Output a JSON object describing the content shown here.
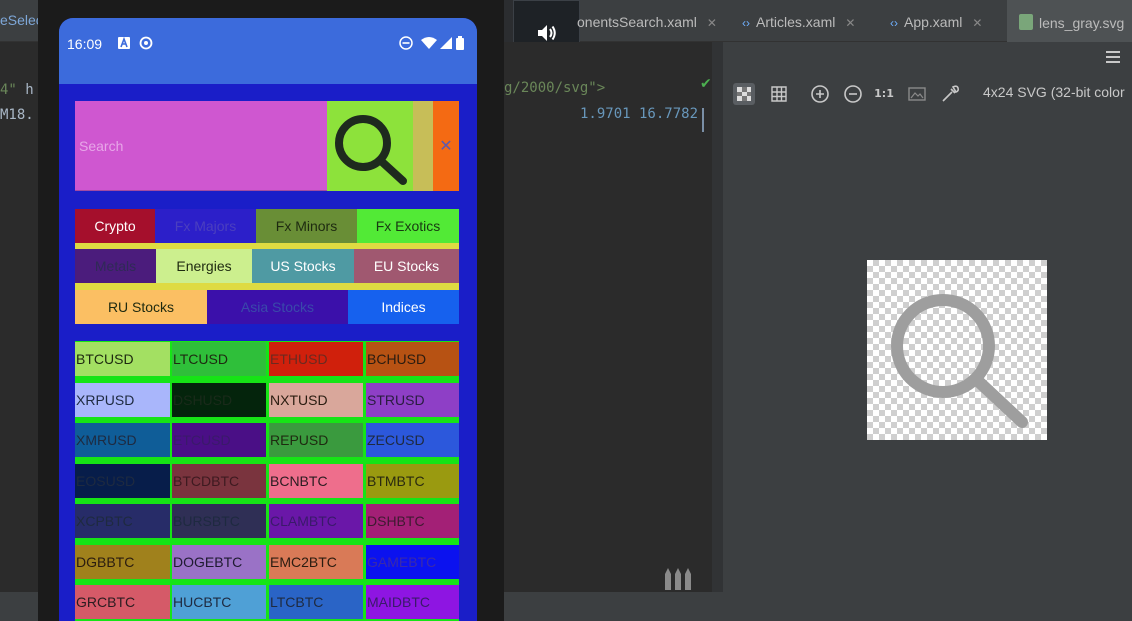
{
  "ide": {
    "left_tab_fragment": "eSelec",
    "left_code_line1_num": "4\"",
    "left_code_line1_rest": " h",
    "left_code_line2": "M18.",
    "tabs": [
      {
        "label": "onentsSearch.xaml",
        "close": "✕"
      },
      {
        "label": "Articles.xaml",
        "close": "✕"
      },
      {
        "label": "App.xaml",
        "close": "✕"
      },
      {
        "label": "lens_gray.svg",
        "close": "✕"
      }
    ],
    "code_line1": "g/2000/svg\">",
    "code_line2": "1.9701 16.7782",
    "preview_info": "4x24 SVG (32-bit color",
    "zoom_label": "1:1"
  },
  "status_bar": {
    "time": "16:09"
  },
  "search": {
    "placeholder": "Search",
    "clear_glyph": "✕"
  },
  "categories": [
    {
      "label": "Crypto",
      "bg": "#a50f2c",
      "fg": "#ffffff"
    },
    {
      "label": "Fx Majors",
      "bg": "#2c1fc9",
      "fg": "#4b3fbf"
    },
    {
      "label": "Fx Minors",
      "bg": "#698e36",
      "fg": "#1e2a10"
    },
    {
      "label": "Fx Exotics",
      "bg": "#52ea36",
      "fg": "#183a12"
    },
    {
      "label": "Metals",
      "bg": "#4b1c7c",
      "fg": "#2f2a56"
    },
    {
      "label": "Energies",
      "bg": "#ccef8e",
      "fg": "#1e2a10"
    },
    {
      "label": "US Stocks",
      "bg": "#4f9aa3",
      "fg": "#ffffff"
    },
    {
      "label": "EU Stocks",
      "bg": "#a05870",
      "fg": "#ffffff"
    },
    {
      "label": "RU Stocks",
      "bg": "#fbbf63",
      "fg": "#1e2a10"
    },
    {
      "label": "Asia Stocks",
      "bg": "#3b10aa",
      "fg": "#3a4aaa"
    },
    {
      "label": "Indices",
      "bg": "#1661ee",
      "fg": "#ffffff"
    }
  ],
  "symbols": [
    {
      "label": "BTCUSD",
      "bg": "#a3e062",
      "fg": "#1e2a10"
    },
    {
      "label": "LTCUSD",
      "bg": "#2fbf3a",
      "fg": "#1e2a10"
    },
    {
      "label": "ETHUSD",
      "bg": "#d0200c",
      "fg": "#6b2a20"
    },
    {
      "label": "BCHUSD",
      "bg": "#b75213",
      "fg": "#2a1c10"
    },
    {
      "label": "XRPUSD",
      "bg": "#a9b6fb",
      "fg": "#1e2a40"
    },
    {
      "label": "DSHUSD",
      "bg": "#04240c",
      "fg": "#1a2a1a"
    },
    {
      "label": "NXTUSD",
      "bg": "#d9a79b",
      "fg": "#2a1c10"
    },
    {
      "label": "STRUSD",
      "bg": "#8e3fc6",
      "fg": "#2a1c40"
    },
    {
      "label": "XMRUSD",
      "bg": "#0f5d98",
      "fg": "#1e2a40"
    },
    {
      "label": "ETCUSD",
      "bg": "#4a0f86",
      "fg": "#3a1a6a"
    },
    {
      "label": "REPUSD",
      "bg": "#3a9a3e",
      "fg": "#1e2a10"
    },
    {
      "label": "ZECUSD",
      "bg": "#2c58dc",
      "fg": "#1e2a40"
    },
    {
      "label": "EOSUSD",
      "bg": "#071d4a",
      "fg": "#1e2a40"
    },
    {
      "label": "BTCDBTC",
      "bg": "#7a343e",
      "fg": "#3e1a20"
    },
    {
      "label": "BCNBTC",
      "bg": "#ee6e8c",
      "fg": "#2a1c20"
    },
    {
      "label": "BTMBTC",
      "bg": "#9a9a10",
      "fg": "#2a2a10"
    },
    {
      "label": "XCPBTC",
      "bg": "#272c68",
      "fg": "#1e2a40"
    },
    {
      "label": "BURSBTC",
      "bg": "#2f2f55",
      "fg": "#1e2a40"
    },
    {
      "label": "CLAMBTC",
      "bg": "#6a17a8",
      "fg": "#3a1a6a"
    },
    {
      "label": "DSHBTC",
      "bg": "#a32076",
      "fg": "#3e1a30"
    },
    {
      "label": "DGBBTC",
      "bg": "#a0811c",
      "fg": "#2a1c10"
    },
    {
      "label": "DOGEBTC",
      "bg": "#9a72c6",
      "fg": "#1e1a30"
    },
    {
      "label": "EMC2BTC",
      "bg": "#d97a57",
      "fg": "#2a1c10"
    },
    {
      "label": "GAMEBTC",
      "bg": "#0b12ef",
      "fg": "#3a2aaa"
    },
    {
      "label": "GRCBTC",
      "bg": "#d55a68",
      "fg": "#2a1c20"
    },
    {
      "label": "HUCBTC",
      "bg": "#4fa0d6",
      "fg": "#1e2a40"
    },
    {
      "label": "LTCBTC",
      "bg": "#2a64c6",
      "fg": "#1e2a40"
    },
    {
      "label": "MAIDBTC",
      "bg": "#8e15e2",
      "fg": "#3a1a6a"
    }
  ],
  "colors": {
    "status_bar": "#3c6bdc",
    "app_bg": "#1a1ec8",
    "search_bg": "#cf57d0",
    "search_button": "#8de23b",
    "clear_button": "#f46a13",
    "category_bg": "#dedb42",
    "grid_bg": "#16e416"
  },
  "icons": {
    "emulator_toolbar": [
      "volume-up-icon",
      "volume-down-icon",
      "rotate-left-icon",
      "rotate-right-icon",
      "camera-icon",
      "zoom-icon",
      "back-icon",
      "home-icon",
      "overview-icon",
      "more-icon"
    ],
    "preview_toolbar": [
      "checker-background-icon",
      "grid-icon",
      "zoom-in-icon",
      "zoom-out-icon",
      "image-icon",
      "eyedropper-icon"
    ]
  }
}
